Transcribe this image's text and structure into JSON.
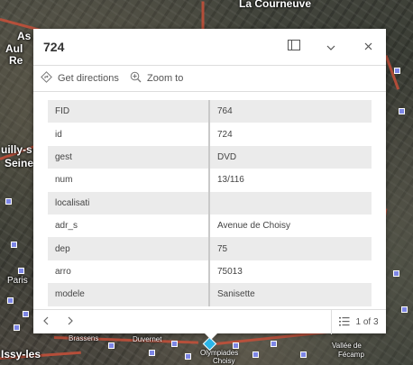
{
  "map": {
    "labels": [
      "La Courneuve",
      "As",
      "Aul",
      "Re",
      "uilly-s",
      "Seine",
      "Paris",
      "Issy-les",
      "Brassens",
      "Duvernet",
      "Olympiades",
      "Choisy",
      "Vallée de",
      "Fécamp"
    ],
    "selected_color": "#2bb5e8",
    "feature_color": "#7d86e6"
  },
  "popup": {
    "title": "724",
    "dock_icon": "dock-icon",
    "collapse_icon": "chevron-down-icon",
    "close_icon": "close-icon",
    "actions": [
      {
        "label": "Get directions",
        "icon": "directions-icon"
      },
      {
        "label": "Zoom to",
        "icon": "zoom-to-icon"
      }
    ],
    "attributes": [
      {
        "key": "FID",
        "value": "764"
      },
      {
        "key": "id",
        "value": "724"
      },
      {
        "key": "gest",
        "value": "DVD"
      },
      {
        "key": "num",
        "value": "13/116"
      },
      {
        "key": "localisati",
        "value": ""
      },
      {
        "key": "adr_s",
        "value": "Avenue de Choisy"
      },
      {
        "key": "dep",
        "value": "75"
      },
      {
        "key": "arro",
        "value": "75013"
      },
      {
        "key": "modele",
        "value": "Sanisette"
      }
    ],
    "footer": {
      "prev_icon": "chevron-left-icon",
      "next_icon": "chevron-right-icon",
      "pager_text": "1 of 3",
      "list_icon": "list-icon"
    }
  }
}
